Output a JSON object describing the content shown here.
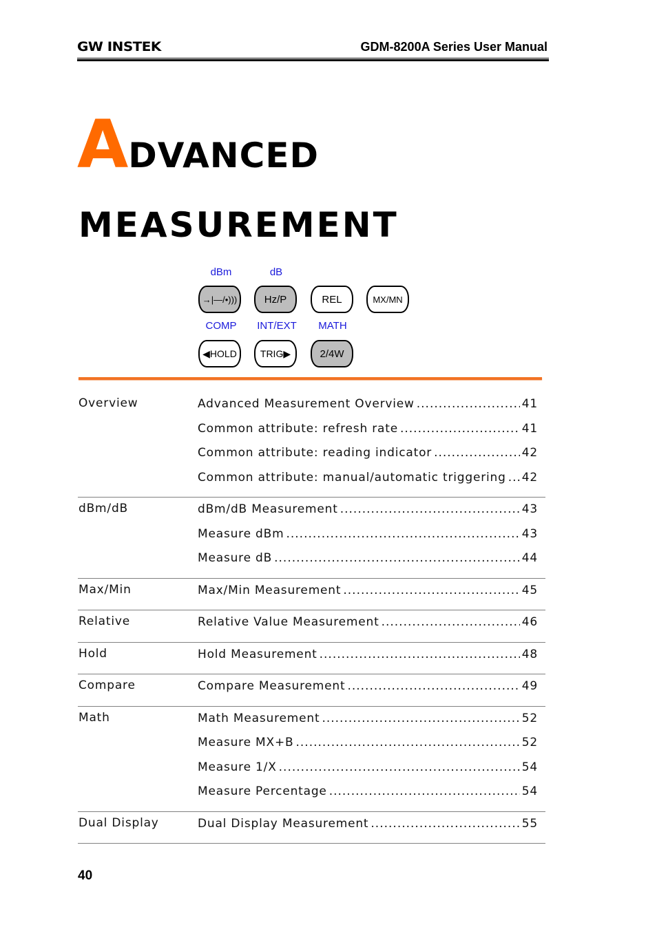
{
  "header": {
    "logo": "GW INSTEK",
    "title": "GDM-8200A Series User Manual"
  },
  "chapter": {
    "title_initial": "A",
    "title_rest_line1": "DVANCED",
    "title_line2": "MEASUREMENT",
    "accent_color": "#ff6a00"
  },
  "front_panel": {
    "shift_labels": [
      "dBm",
      "dB",
      "COMP",
      "INT/EXT",
      "MATH"
    ],
    "keys": [
      {
        "label": "→|—/•)))",
        "style": "gray",
        "icon": "diode-continuity-icon"
      },
      {
        "label": "Hz/P",
        "style": "gray"
      },
      {
        "label": "REL",
        "style": "white"
      },
      {
        "label": "MX/MN",
        "style": "white"
      },
      {
        "label": "◀HOLD",
        "style": "white"
      },
      {
        "label": "TRIG▶",
        "style": "white"
      },
      {
        "label": "2/4W",
        "style": "gray"
      }
    ]
  },
  "toc": [
    {
      "section": "Overview",
      "entries": [
        {
          "title": "Advanced Measurement Overview",
          "page": "41"
        },
        {
          "title": "Common attribute: refresh rate",
          "page": "41"
        },
        {
          "title": "Common attribute: reading indicator",
          "page": "42"
        },
        {
          "title": "Common attribute: manual/automatic triggering",
          "page": "42"
        }
      ]
    },
    {
      "section": "dBm/dB",
      "entries": [
        {
          "title": "dBm/dB Measurement",
          "page": "43"
        },
        {
          "title": "Measure dBm",
          "page": "43"
        },
        {
          "title": "Measure dB",
          "page": "44"
        }
      ]
    },
    {
      "section": "Max/Min",
      "entries": [
        {
          "title": "Max/Min Measurement",
          "page": "45"
        }
      ]
    },
    {
      "section": "Relative",
      "entries": [
        {
          "title": "Relative Value Measurement",
          "page": "46"
        }
      ]
    },
    {
      "section": "Hold",
      "entries": [
        {
          "title": "Hold Measurement",
          "page": "48"
        }
      ]
    },
    {
      "section": "Compare",
      "entries": [
        {
          "title": "Compare Measurement",
          "page": "49"
        }
      ]
    },
    {
      "section": "Math",
      "entries": [
        {
          "title": "Math Measurement",
          "page": "52"
        },
        {
          "title": "Measure MX+B",
          "page": "52"
        },
        {
          "title": "Measure 1/X",
          "page": "54"
        },
        {
          "title": "Measure Percentage",
          "page": "54"
        }
      ]
    },
    {
      "section": "Dual Display",
      "entries": [
        {
          "title": "Dual Display Measurement",
          "page": "55"
        }
      ]
    }
  ],
  "footer": {
    "page_number": "40"
  }
}
